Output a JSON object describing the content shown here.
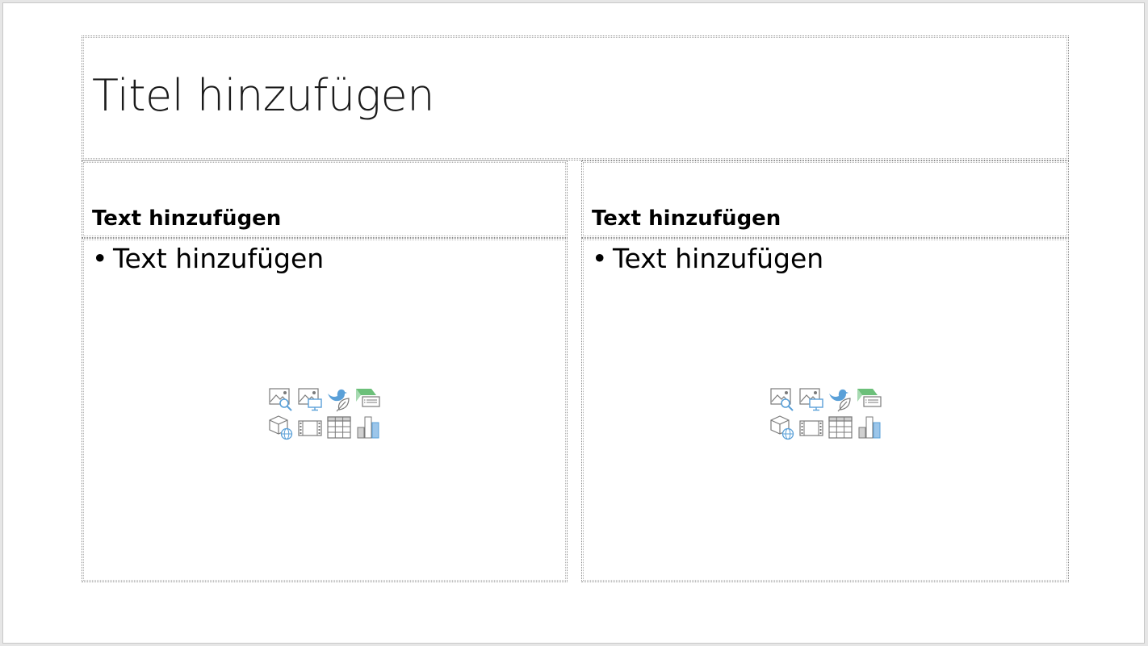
{
  "slide": {
    "title_placeholder": "Titel hinzufügen",
    "left_column": {
      "heading_placeholder": "Text hinzufügen",
      "bullet_char": "•",
      "body_placeholder": "Text hinzufügen"
    },
    "right_column": {
      "heading_placeholder": "Text hinzufügen",
      "bullet_char": "•",
      "body_placeholder": "Text hinzufügen"
    },
    "insert_icons": [
      "picture-search-icon",
      "online-picture-icon",
      "icons-icon",
      "smartart-icon",
      "3d-model-icon",
      "video-icon",
      "table-icon",
      "chart-icon"
    ]
  },
  "colors": {
    "placeholder_border": "#8a8a8a",
    "icon_gray": "#7a7a7a",
    "icon_blue": "#5aa0d8",
    "icon_green": "#6cc07a"
  }
}
